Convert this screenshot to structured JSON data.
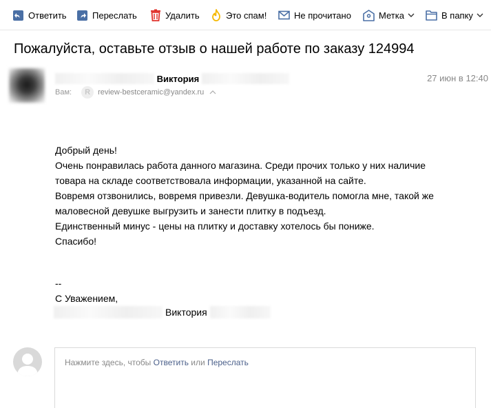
{
  "toolbar": {
    "reply": "Ответить",
    "forward": "Переслать",
    "delete": "Удалить",
    "spam": "Это спам!",
    "unread": "Не прочитано",
    "label": "Метка",
    "to_folder": "В папку"
  },
  "message": {
    "subject": "Пожалуйста, оставьте отзыв о нашей работе по заказу 124994",
    "sender_name": "Виктория",
    "date": "27 июн в 12:40",
    "to_label": "Вам:",
    "to_badge": "R",
    "to_email": "review-bestceramic@yandex.ru"
  },
  "body": {
    "lines": [
      "Добрый день!",
      "Очень понравилась работа данного магазина. Среди прочих только у них наличие",
      "товара на складе соответствовала информации, указанной на сайте.",
      "Вовремя отзвонились, вовремя привезли. Девушка-водитель помогла мне, такой же",
      "маловесной девушке выгрузить и занести плитку в подъезд.",
      "Единственный минус - цены на плитку и доставку хотелось бы пониже.",
      "Спасибо!"
    ],
    "sig_dashes": "--",
    "sig_regards": "С Уважением,",
    "sig_name": "Виктория"
  },
  "reply": {
    "hint_prefix": "Нажмите здесь, чтобы",
    "reply_link": "Ответить",
    "or": "или",
    "forward_link": "Переслать"
  },
  "colors": {
    "icon_blue": "#4a6fa5",
    "delete_red": "#e0302a",
    "spam_yellow": "#f5b800",
    "link": "#4a5f8a"
  }
}
